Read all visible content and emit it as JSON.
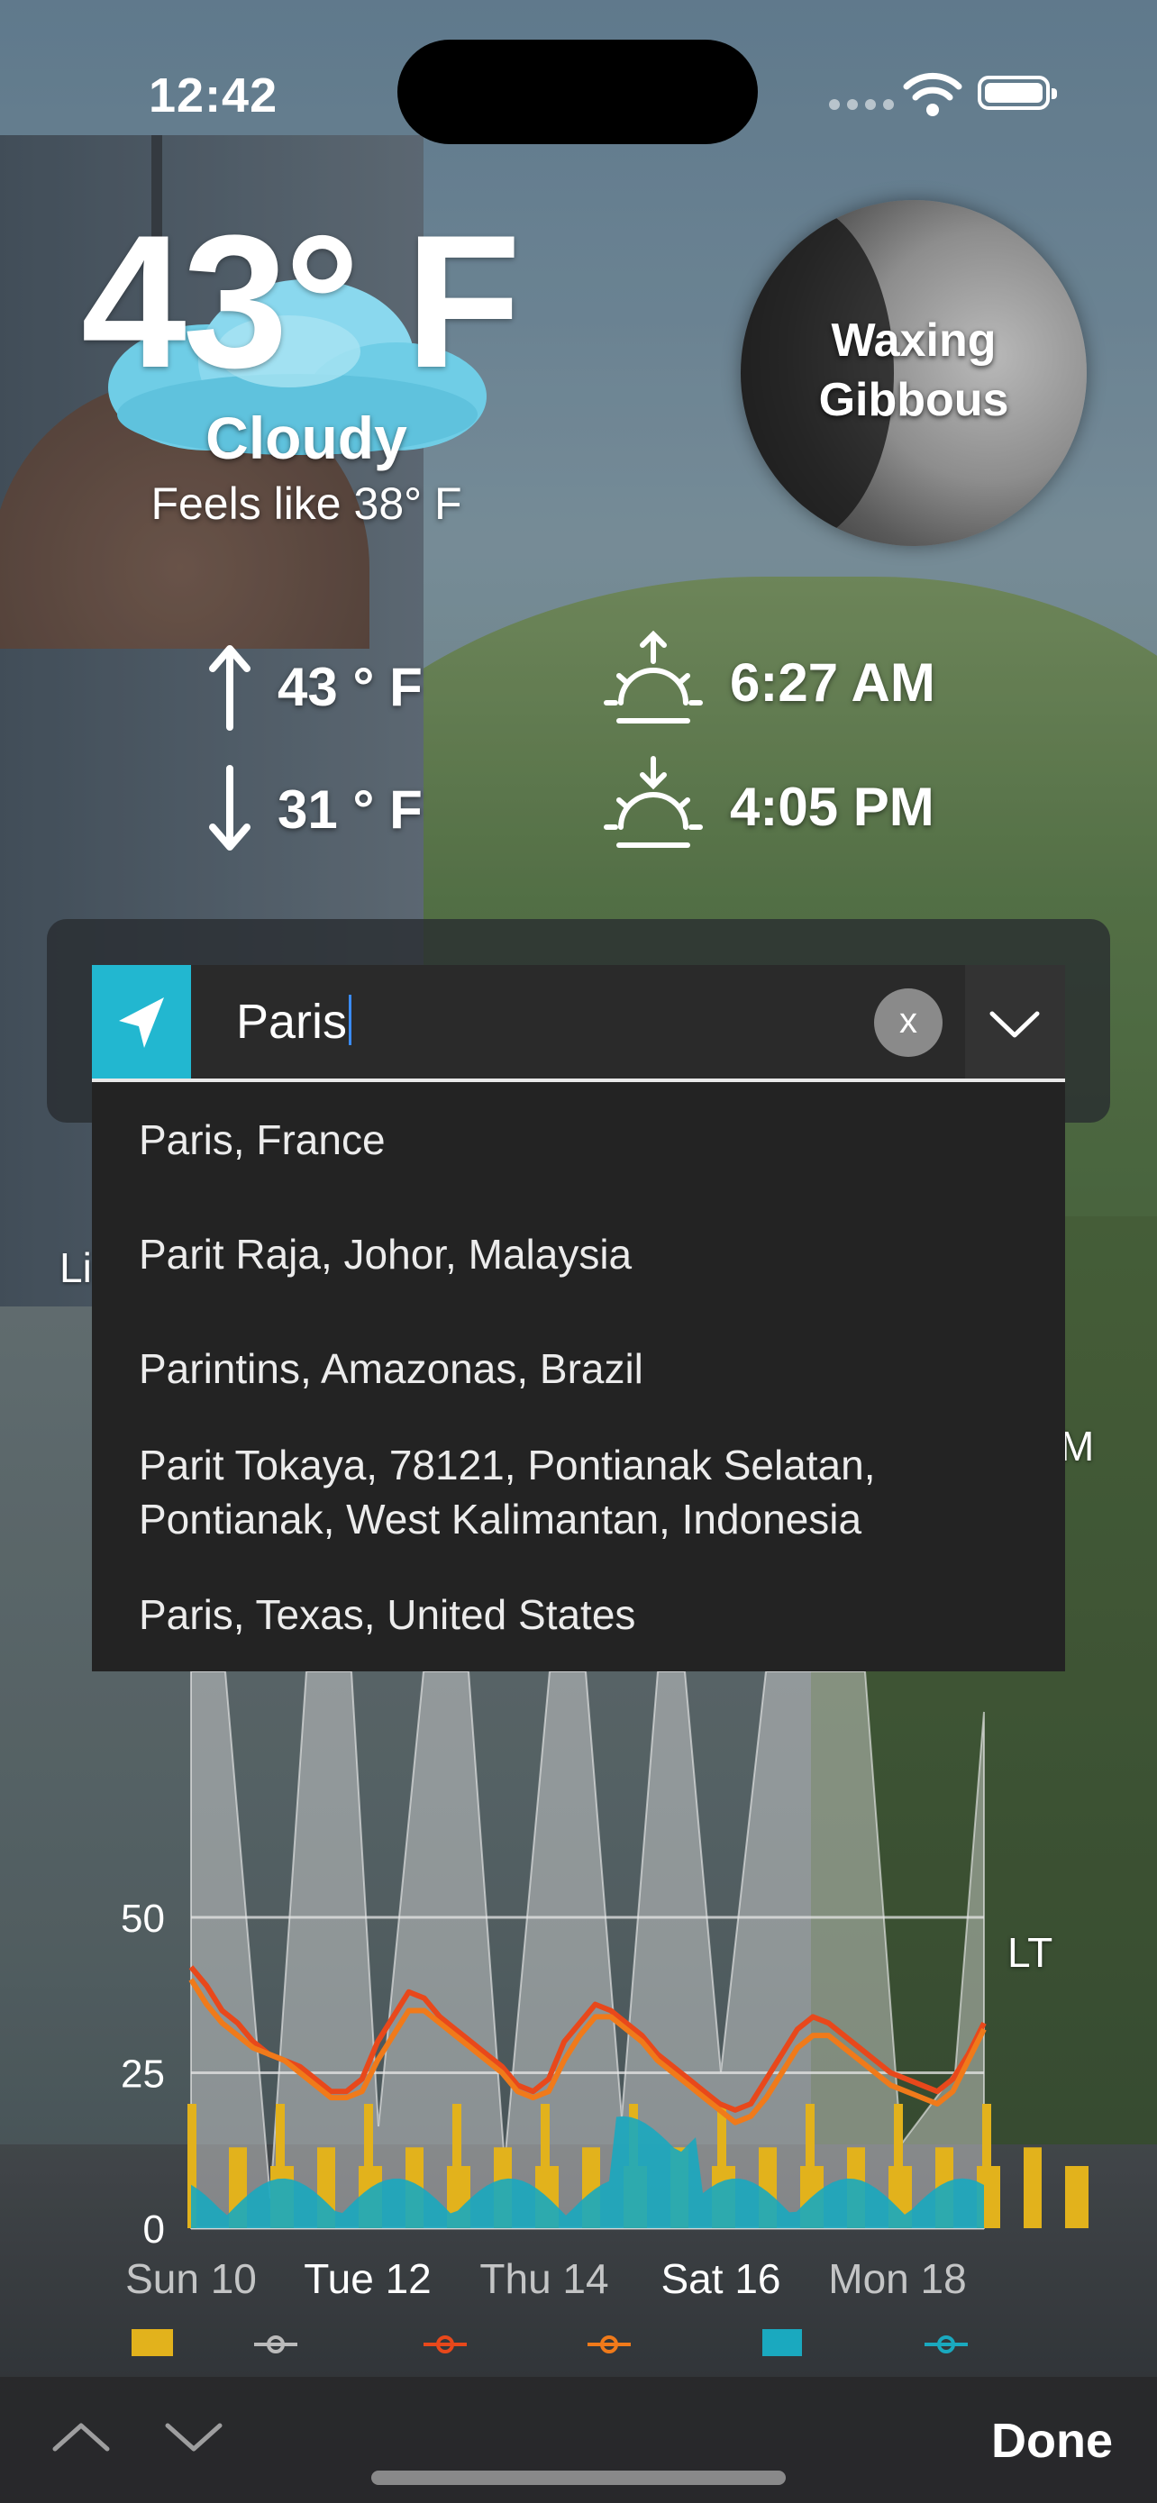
{
  "status_bar": {
    "time": "12:42"
  },
  "weather": {
    "temperature": "43° F",
    "condition": "Cloudy",
    "feels_like": "Feels like 38° F",
    "high": "43 ° F",
    "low": "31 ° F",
    "sunrise": "6:27 AM",
    "sunset": "4:05 PM",
    "moon_phase": "Waxing\nGibbous",
    "icon": "cloud-icon"
  },
  "search": {
    "value": "Paris",
    "clear_label": "x",
    "suggestions": [
      "Paris, France",
      "Parit Raja, Johor, Malaysia",
      "Parintins, Amazonas, Brazil",
      "Parit Tokaya, 78121, Pontianak Selatan,\nPontianak, West Kalimantan, Indonesia",
      "Paris, Texas, United States"
    ]
  },
  "background_labels": {
    "left": "Li",
    "right_m": "M",
    "right_lt": "LT"
  },
  "chart_data": {
    "type": "area",
    "categories": [
      "Sun 10",
      "Tue 12",
      "Thu 14",
      "Sat 16",
      "Mon 18"
    ],
    "yticks": [
      0,
      25,
      50
    ],
    "ylim": [
      0,
      60
    ],
    "series": [
      {
        "values": [
          42,
          39,
          35,
          33,
          30,
          28,
          27,
          26,
          24,
          22,
          22,
          24,
          30,
          34,
          38,
          37,
          34,
          32,
          30,
          28,
          26,
          23,
          22,
          24,
          30,
          33,
          36,
          35,
          33,
          31,
          28,
          26,
          24,
          22,
          20,
          19,
          20,
          24,
          28,
          32,
          34,
          33,
          31,
          29,
          27,
          25,
          24,
          23,
          22,
          24,
          28,
          33
        ]
      },
      {
        "values": [
          40,
          36,
          33,
          31,
          29,
          28,
          27,
          25,
          23,
          21,
          21,
          22,
          27,
          31,
          35,
          35,
          33,
          31,
          29,
          27,
          25,
          22,
          21,
          22,
          27,
          31,
          34,
          34,
          32,
          30,
          27,
          25,
          23,
          21,
          19,
          17,
          18,
          21,
          25,
          29,
          31,
          31,
          29,
          27,
          25,
          23,
          22,
          21,
          20,
          22,
          27,
          32
        ]
      }
    ],
    "legend_icons": [
      "bar-swatch",
      "gray-line-marker",
      "red-line-marker",
      "orange-line-marker",
      "teal-swatch",
      "teal-line-marker"
    ]
  },
  "keyboard_bar": {
    "done_label": "Done"
  },
  "colors": {
    "accent": "#22b7d0",
    "orange": "#f07a1a",
    "red": "#e8481b",
    "gold": "#e2b21c",
    "teal": "#1aa9bf"
  }
}
